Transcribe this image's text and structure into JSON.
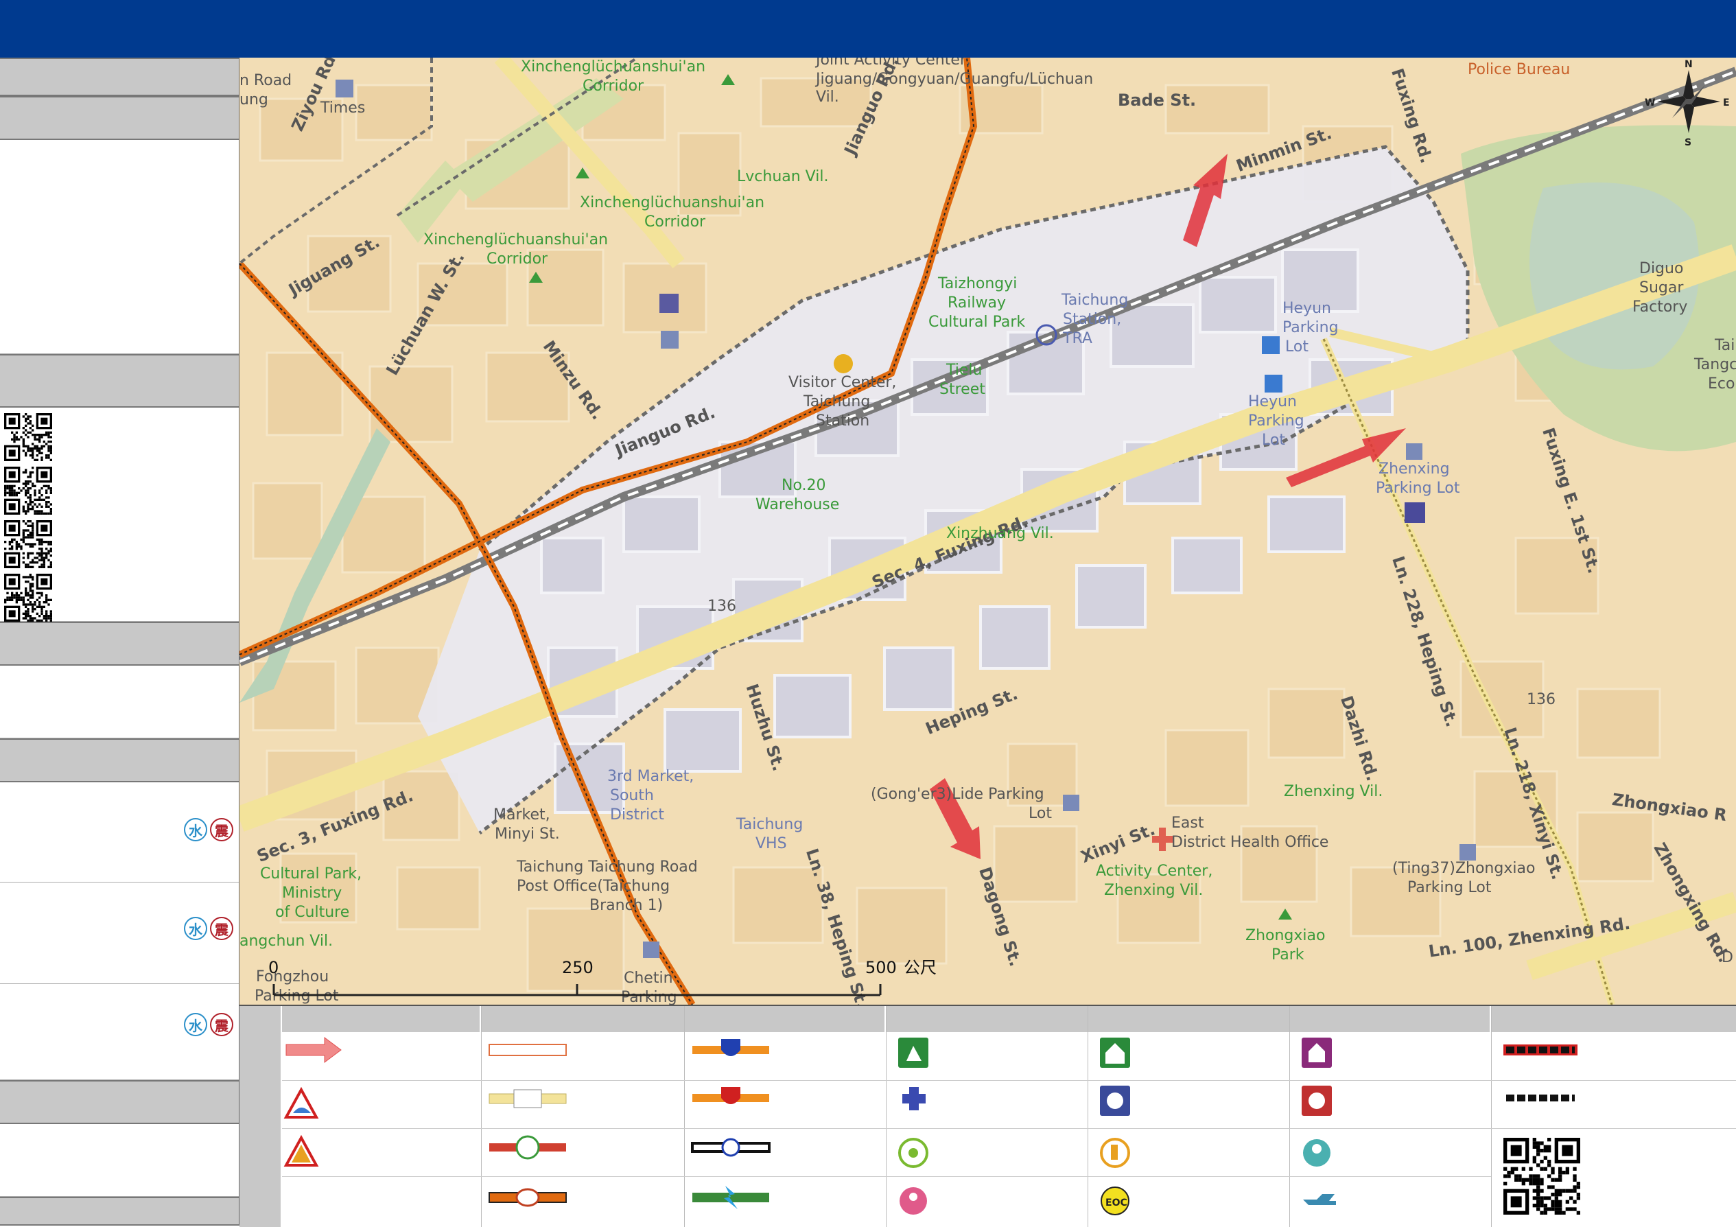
{
  "map": {
    "labels": {
      "road_top_left": "n Road",
      "ung": "ung",
      "times": "Times",
      "ziyou": "Ziyou Rd.",
      "corridor1_a": "Xinchenglüchuanshui'an",
      "corridor1_b": "Corridor",
      "joint_a": "Joint Activity Center,",
      "joint_b": "Jiguang/Gongyuan/Guangfu/Lüchuan",
      "joint_c": "Vil.",
      "police": "Police Bureau",
      "bade": "Bade St.",
      "fuxing_rd": "Fuxing Rd.",
      "jianguo_rd_top": "Jianguo Rd.",
      "lvchuan": "Lvchuan Vil.",
      "corridor2_a": "Xinchenglüchuanshui'an",
      "corridor2_b": "Corridor",
      "corridor3_a": "Xinchenglüchuanshui'an",
      "corridor3_b": "Corridor",
      "jiguang": "Jiguang St.",
      "minquan": "Minmin St.",
      "diguo_a": "Diguo",
      "diguo_b": "Sugar",
      "diguo_c": "Factory",
      "tangcl_a": "Tai",
      "tangcl_b": "Tangcl",
      "tangcl_c": "Ecol",
      "taizhongyi_a": "Taizhongyi",
      "taizhongyi_b": "Railway",
      "taizhongyi_c": "Cultural Park",
      "station_a": "Taichung",
      "station_b": "Station,",
      "station_c": "TRA",
      "heyun1_a": "Heyun",
      "heyun1_b": "Parking",
      "heyun1_c": "Lot",
      "luchuan_w": "Lüchuan W. St.",
      "minzu": "Minzu Rd.",
      "visitor_a": "Visitor Center,",
      "visitor_b": "Taichung",
      "visitor_c": "Station",
      "tielu_a": "Tielu",
      "tielu_b": "Street",
      "heyun2_a": "Heyun",
      "heyun2_b": "Parking",
      "heyun2_c": "Lot",
      "jianguo_rd": "Jianguo Rd.",
      "zhenxing_pl_a": "Zhenxing",
      "zhenxing_pl_b": "Parking Lot",
      "no20_a": "No.20",
      "no20_b": "Warehouse",
      "fuxing_sec4": "Sec. 4, Fuxing Rd.",
      "xinzhuang": "Xinzhuang Vil.",
      "fuxing_e1": "Fuxing E. 1st St.",
      "r136": "136",
      "ln228": "Ln. 228, Heping St.",
      "huzhu": "Huzhu St.",
      "heping": "Heping St.",
      "dazhi": "Dazhi Rd.",
      "ln218": "Ln. 218, Xinyi St.",
      "fuxing_sec3": "Sec. 3, Fuxing Rd.",
      "market3_a": "3rd Market,",
      "market3_b": "South",
      "market3_c": "District",
      "lide_a": "(Gong'er3)Lide Parking",
      "lide_b": "Lot",
      "zhenxing_vil": "Zhenxing Vil.",
      "zhongxiao": "Zhongxiao R",
      "market_minyi_a": "Market,",
      "market_minyi_b": "Minyi St.",
      "vhs_a": "Taichung",
      "vhs_b": "VHS",
      "xinyi": "Xinyi St.",
      "east_a": "East",
      "east_b": "District Health Office",
      "ting37_a": "(Ting37)Zhongxiao",
      "ting37_b": "Parking Lot",
      "cultural_a": "Cultural Park,",
      "cultural_b": "Ministry",
      "cultural_c": "of Culture",
      "post_a": "Taichung Taichung Road",
      "post_b": "Post Office(Taichung",
      "post_c": "Branch 1)",
      "ln38": "Ln. 38, Heping St.",
      "dagong": "Dagong St.",
      "activity_a": "Activity Center,",
      "activity_b": "Zhenxing Vil.",
      "ln100": "Ln. 100, Zhenxing Rd.",
      "zhongxing_rd": "Zhongxing Rd.",
      "gangchun": "angchun Vil.",
      "zhongxiao_park_a": "Zhongxiao",
      "zhongxiao_park_b": "Park",
      "fengzhou_a": "Fongzhou",
      "fengzhou_b": "Parking Lot",
      "chetin_a": "Chetin",
      "chetin_b": "Parking",
      "d_right": "D",
      "r136b": "136"
    },
    "compass": {
      "n": "N",
      "s": "S",
      "e": "E",
      "w": "W"
    },
    "scale": {
      "t0": "0",
      "t250": "250",
      "t500": "500",
      "unit": "公尺"
    }
  },
  "sidebar": {
    "badges": {
      "water": "水",
      "quake": "震"
    }
  },
  "colors": {
    "header": "#003a8f",
    "boundary_orange": "#e06a10",
    "zone_fill": "#e9e8f0",
    "arrow_red": "#e0303a",
    "base_map": "#f2ddb5"
  },
  "legend": {
    "icons": [
      "evacuation-arrow",
      "landslide-warning",
      "debris-flow-warning",
      "road-outline",
      "provincial-road",
      "county-road",
      "railway-station-line",
      "national-highway",
      "expressway",
      "mrt-line",
      "hsr-line",
      "shelter-outdoor",
      "medical-aid",
      "accessible",
      "family-shelter",
      "indoor-shelter",
      "police-station",
      "elderly-shelter",
      "eoc",
      "fire-station",
      "temple-shelter",
      "infant-shelter",
      "helicopter",
      "boundary-red-black",
      "boundary-black"
    ],
    "eoc": "EOC"
  }
}
